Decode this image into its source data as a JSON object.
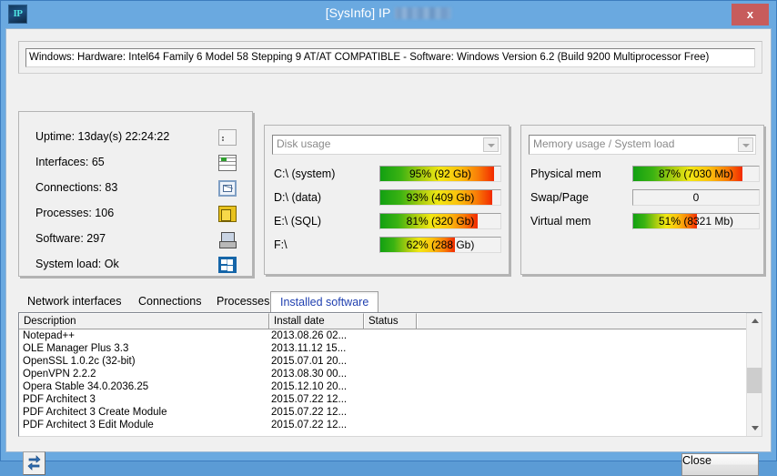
{
  "window": {
    "app_icon_label": "IP",
    "title": "[SysInfo]  IP",
    "ip_redacted": true,
    "close_label": "x"
  },
  "banner": {
    "text": "Windows: Hardware: Intel64 Family 6 Model 58 Stepping 9 AT/AT COMPATIBLE - Software: Windows Version 6.2 (Build 9200 Multiprocessor Free)"
  },
  "info_panel": {
    "rows": [
      {
        "label": "Uptime: 13day(s) 22:24:22",
        "icon": "monitor-chart-icon"
      },
      {
        "label": "Interfaces: 65",
        "icon": "document-list-icon"
      },
      {
        "label": "Connections: 83",
        "icon": "envelope-icon"
      },
      {
        "label": "Processes: 106",
        "icon": "package-box-icon"
      },
      {
        "label": "Software: 297",
        "icon": "computer-icon"
      },
      {
        "label": "System load: Ok",
        "icon": "windows-logo-icon"
      }
    ]
  },
  "disk_panel": {
    "combo_value": "Disk usage",
    "bars": [
      {
        "label": "C:\\ (system)",
        "percent": 95,
        "text": "95% (92 Gb)"
      },
      {
        "label": "D:\\ (data)",
        "percent": 93,
        "text": "93% (409 Gb)"
      },
      {
        "label": "E:\\ (SQL)",
        "percent": 81,
        "text": "81% (320 Gb)"
      },
      {
        "label": "F:\\",
        "percent": 62,
        "text": "62% (288 Gb)"
      }
    ]
  },
  "memory_panel": {
    "combo_value": "Memory usage / System load",
    "bars": [
      {
        "label": "Physical mem",
        "percent": 87,
        "text": "87% (7030 Mb)"
      },
      {
        "label": "Swap/Page",
        "percent": 0,
        "text": "0"
      },
      {
        "label": "Virtual mem",
        "percent": 51,
        "text": "51% (8321 Mb)"
      }
    ]
  },
  "tabs": {
    "items": [
      {
        "label": "Network interfaces",
        "active": false
      },
      {
        "label": "Connections",
        "active": false
      },
      {
        "label": "Processes",
        "active": false
      },
      {
        "label": "Installed software",
        "active": true
      }
    ],
    "active_color": "#2040b0"
  },
  "list": {
    "columns": [
      "Description",
      "Install date",
      "Status"
    ],
    "rows": [
      {
        "description": "Notepad++",
        "install_date": "2013.08.26 02...",
        "status": ""
      },
      {
        "description": "OLE Manager Plus 3.3",
        "install_date": "2013.11.12 15...",
        "status": ""
      },
      {
        "description": "OpenSSL 1.0.2c (32-bit)",
        "install_date": "2015.07.01 20...",
        "status": ""
      },
      {
        "description": "OpenVPN 2.2.2",
        "install_date": "2013.08.30 00...",
        "status": ""
      },
      {
        "description": "Opera Stable 34.0.2036.25",
        "install_date": "2015.12.10 20...",
        "status": ""
      },
      {
        "description": "PDF Architect 3",
        "install_date": "2015.07.22 12...",
        "status": ""
      },
      {
        "description": "PDF Architect 3 Create Module",
        "install_date": "2015.07.22 12...",
        "status": ""
      },
      {
        "description": "PDF Architect 3 Edit Module",
        "install_date": "2015.07.22 12...",
        "status": ""
      }
    ]
  },
  "footer": {
    "refresh_icon": "refresh-icon",
    "close_label": "Close"
  }
}
